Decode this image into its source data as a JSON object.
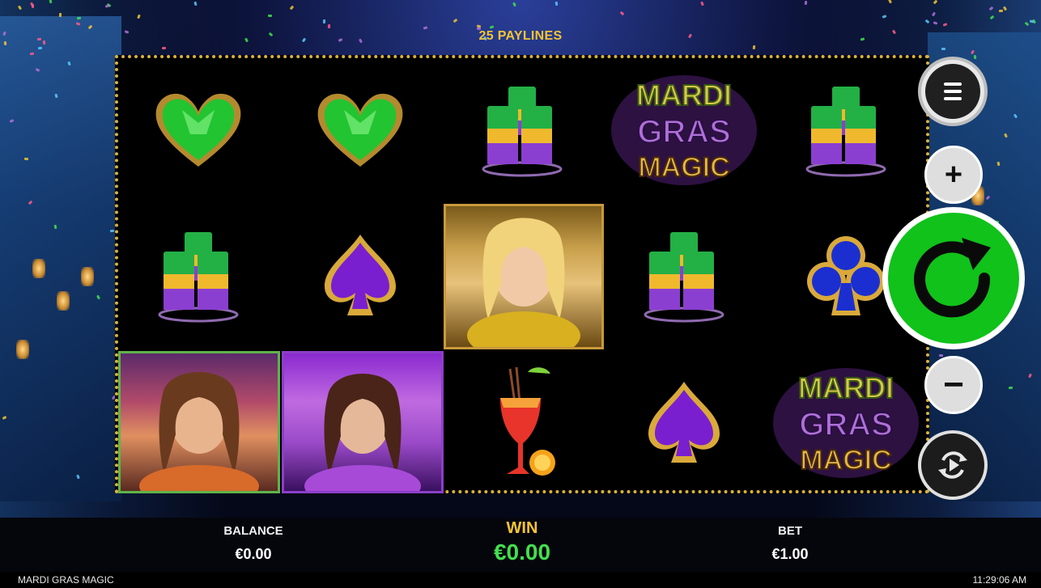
{
  "game": {
    "paylines_label": "25 PAYLINES",
    "logo_text": [
      "MARDI",
      "GRAS",
      "MAGIC"
    ]
  },
  "reels": {
    "grid_rows": [
      [
        "green-heart-icon",
        "green-heart-icon",
        "shot-glasses-icon",
        "mardi-gras-magic-logo",
        "shot-glasses-icon"
      ],
      [
        "shot-glasses-icon",
        "purple-spade-icon",
        "gold-dancer-portrait",
        "shot-glasses-icon",
        "blue-club-icon"
      ],
      [
        "green-dancer-portrait",
        "purple-dancer-portrait",
        "cocktail-icon",
        "purple-spade-icon",
        "mardi-gras-magic-logo"
      ]
    ]
  },
  "controls": {
    "menu_icon": "hamburger-menu-icon",
    "increase_label": "+",
    "decrease_label": "−",
    "spin_icon": "spin-arrow-icon",
    "autoplay_icon": "autoplay-icon"
  },
  "stats": {
    "balance_label": "BALANCE",
    "balance_value": "€0.00",
    "win_label": "WIN",
    "win_value": "€0.00",
    "bet_label": "BET",
    "bet_value": "€1.00"
  },
  "footer": {
    "game_title": "MARDI GRAS MAGIC",
    "clock": "11:29:06 AM"
  },
  "colors": {
    "accent_gold": "#f5c533",
    "win_green": "#42e04e",
    "spin_green": "#10c21a"
  }
}
